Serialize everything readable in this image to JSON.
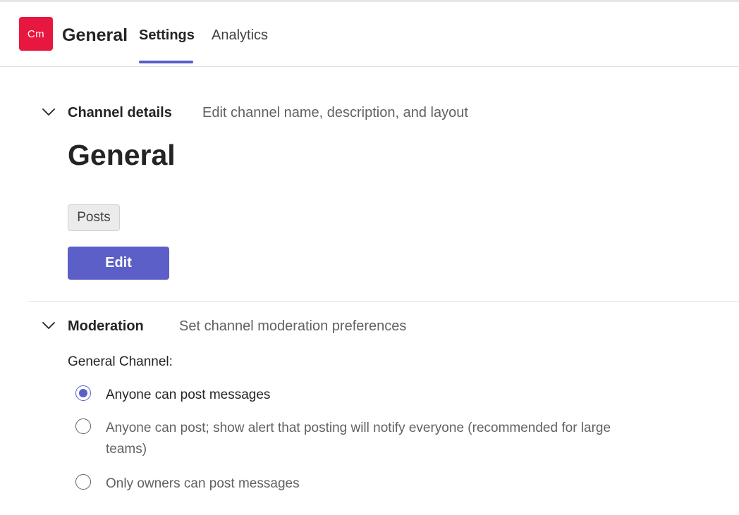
{
  "header": {
    "avatar_initials": "Cm",
    "title": "General",
    "tabs": [
      {
        "label": "Settings",
        "active": true
      },
      {
        "label": "Analytics",
        "active": false
      }
    ],
    "accent_color": "#5b5fc7",
    "avatar_color": "#e8173f"
  },
  "channel_details": {
    "title": "Channel details",
    "description": "Edit channel name, description, and layout",
    "channel_name": "General",
    "tag": "Posts",
    "edit_label": "Edit",
    "expanded": true,
    "icon": "chevron-down-icon"
  },
  "moderation": {
    "title": "Moderation",
    "description": "Set channel moderation preferences",
    "group_label": "General Channel:",
    "expanded": true,
    "icon": "chevron-down-icon",
    "options": [
      {
        "label": "Anyone can post messages",
        "selected": true
      },
      {
        "label": "Anyone can post; show alert that posting will notify everyone (recommended for large teams)",
        "selected": false
      },
      {
        "label": "Only owners can post messages",
        "selected": false
      }
    ]
  }
}
